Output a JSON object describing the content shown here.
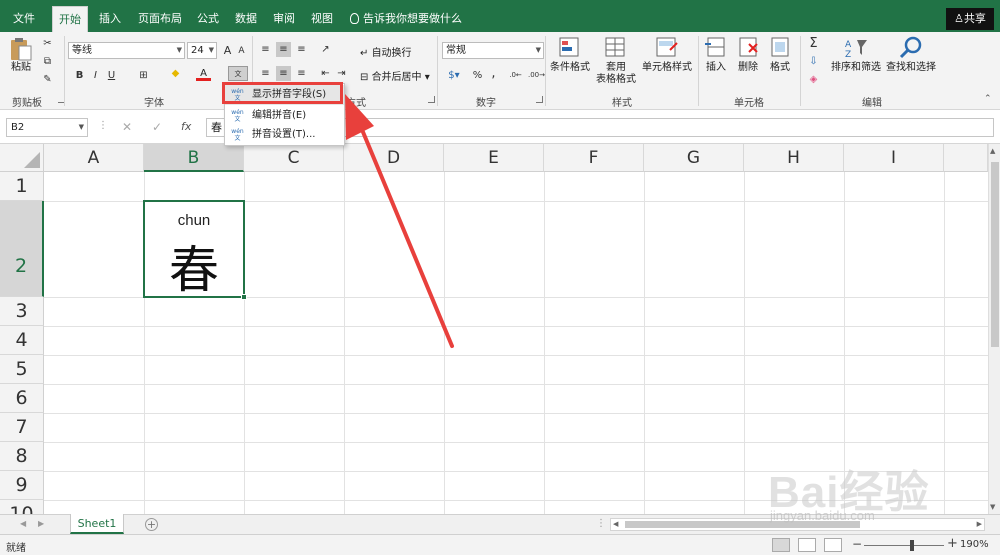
{
  "tabs": [
    "文件",
    "开始",
    "插入",
    "页面布局",
    "公式",
    "数据",
    "审阅",
    "视图"
  ],
  "active_tab": "开始",
  "tell_me": "告诉我你想要做什么",
  "share": "共享",
  "ribbon": {
    "clipboard": {
      "paste": "粘贴",
      "label": "剪贴板"
    },
    "font": {
      "name": "等线",
      "size": "24",
      "bold": "B",
      "italic": "I",
      "underline": "U",
      "grow": "A",
      "shrink": "A",
      "label": "字体",
      "font_color_hex": "#e3201f"
    },
    "alignment": {
      "wrap": "自动换行",
      "merge": "合并后居中",
      "label": "对齐方式",
      "label_visible": "方式"
    },
    "number": {
      "format": "常规",
      "percent": "%",
      "comma": ",",
      "label": "数字"
    },
    "styles": {
      "conditional": "条件格式",
      "table_line1": "套用",
      "table_line2": "表格格式",
      "cell_styles": "单元格样式",
      "label": "样式"
    },
    "cells": {
      "insert": "插入",
      "delete": "删除",
      "format": "格式",
      "label": "单元格"
    },
    "editing": {
      "sum": "Σ",
      "sort": "排序和筛选",
      "find": "查找和选择",
      "label": "编辑"
    }
  },
  "formula_bar": {
    "name_box": "B2",
    "cancel": "✕",
    "enter": "✓",
    "fx": "fx",
    "content": "春"
  },
  "columns": [
    "A",
    "B",
    "C",
    "D",
    "E",
    "F",
    "G",
    "H",
    "I"
  ],
  "rows": [
    "1",
    "2",
    "3",
    "4",
    "5",
    "6",
    "7",
    "8",
    "9",
    "10"
  ],
  "selected_cell": "B2",
  "cell_b2": {
    "pinyin": "chun",
    "text": "春"
  },
  "sheet_tab": "Sheet1",
  "add_sheet": "+",
  "status": "就绪",
  "zoom": "190%",
  "zoom_minus": "−",
  "zoom_plus": "+",
  "menu": {
    "items": [
      {
        "label": "显示拼音字段(S)"
      },
      {
        "label": "编辑拼音(E)"
      },
      {
        "label": "拼音设置(T)..."
      }
    ],
    "icon_top": "wén",
    "icon_bottom": "文"
  },
  "watermark": {
    "brand": "Bai经验",
    "url": "jingyan.baidu.com"
  },
  "colors": {
    "excel_green": "#217346",
    "highlight_red": "#e8403c"
  }
}
